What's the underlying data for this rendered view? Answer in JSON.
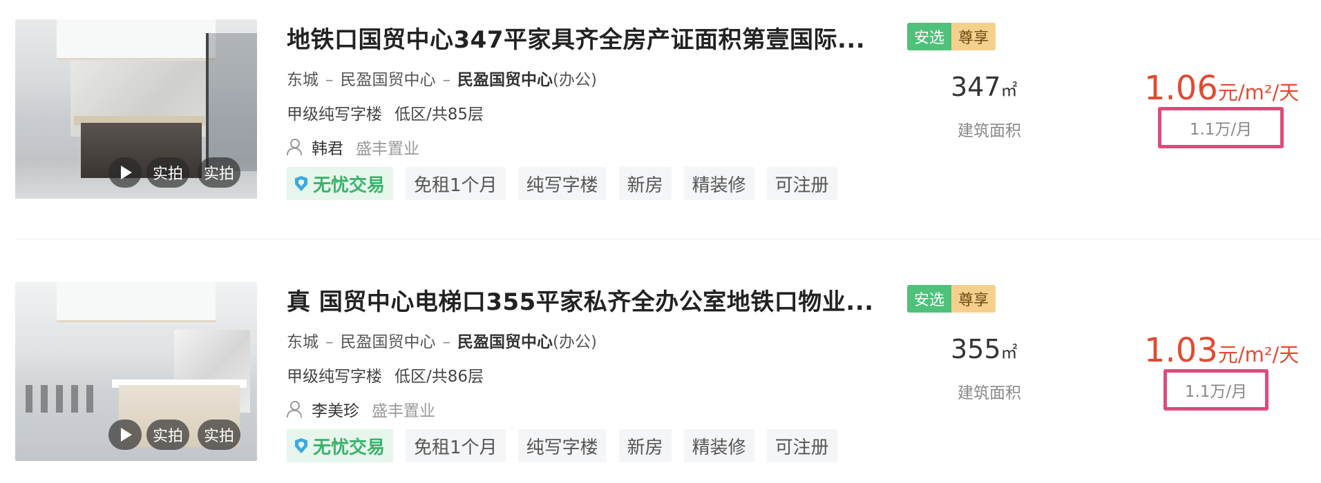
{
  "listings": [
    {
      "title": "地铁口国贸中心347平家具齐全房产证面积第壹国际...",
      "badges": [
        "安选",
        "尊享"
      ],
      "location": {
        "district": "东城",
        "area": "民盈国贸中心",
        "building": "民盈国贸中心",
        "usage": "(办公)"
      },
      "specs": [
        "甲级纯写字楼",
        "低区/共85层"
      ],
      "agent": {
        "name": "韩君",
        "agency": "盛丰置业"
      },
      "tags": [
        "无忧交易",
        "免租1个月",
        "纯写字楼",
        "新房",
        "精装修",
        "可注册"
      ],
      "area_value": "347",
      "area_unit": "㎡",
      "area_label": "建筑面积",
      "price_value": "1.06",
      "price_unit": "元/m²/天",
      "monthly": "1.1万/月",
      "photo_labels": [
        "实拍",
        "实拍"
      ]
    },
    {
      "title": "真 国贸中心电梯口355平家私齐全办公室地铁口物业...",
      "badges": [
        "安选",
        "尊享"
      ],
      "location": {
        "district": "东城",
        "area": "民盈国贸中心",
        "building": "民盈国贸中心",
        "usage": "(办公)"
      },
      "specs": [
        "甲级纯写字楼",
        "低区/共86层"
      ],
      "agent": {
        "name": "李美珍",
        "agency": "盛丰置业"
      },
      "tags": [
        "无忧交易",
        "免租1个月",
        "纯写字楼",
        "新房",
        "精装修",
        "可注册"
      ],
      "area_value": "355",
      "area_unit": "㎡",
      "area_label": "建筑面积",
      "price_value": "1.03",
      "price_unit": "元/m²/天",
      "monthly": "1.1万/月",
      "photo_labels": [
        "实拍",
        "实拍"
      ]
    }
  ],
  "icons": {
    "play": "play-icon",
    "agent": "person-icon",
    "trade": "shield-icon"
  },
  "colors": {
    "price": "#e24a32",
    "highlight_box": "#e0497a",
    "badge_anxuan": "#4fc17a",
    "badge_zunxiang": "#f5cf8c",
    "worry_free": "#3bb26a"
  }
}
